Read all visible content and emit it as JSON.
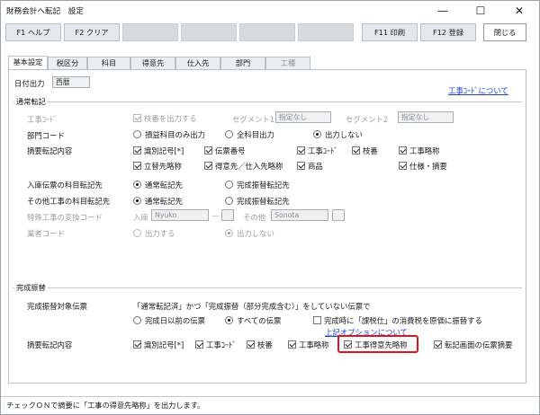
{
  "window": {
    "title": "財務会計へ転記　設定",
    "minimize": "—",
    "maximize": "☐",
    "close": "✕"
  },
  "toolbar": {
    "f1": "F1 ヘルプ",
    "f2": "F2 クリア",
    "f11": "F11 印刷",
    "f12": "F12 登録",
    "close": "閉じる"
  },
  "tabs": [
    "基本設定",
    "税区分",
    "科目",
    "得意先",
    "仕入先",
    "部門",
    "工種"
  ],
  "header": {
    "date_output_label": "日付出力",
    "date_output_value": "西暦",
    "koji_code_link": "工事ｺｰﾄﾞについて"
  },
  "normal": {
    "group_label": "通常転記",
    "koji_code": {
      "label": "工事ｺｰﾄﾞ",
      "checkbox": "枝番を出力する",
      "seg1_label": "セグメント1",
      "seg1_value": "指定なし",
      "seg2_label": "セグメント2",
      "seg2_value": "指定なし"
    },
    "bumon": {
      "label": "部門コード",
      "opt1": "損益科目のみ出力",
      "opt2": "全科目出力",
      "opt3": "出力しない"
    },
    "tekiyo": {
      "label": "摘要転記内容",
      "row1": [
        "識別記号[*]",
        "伝票番号",
        "工事ｺｰﾄﾞ",
        "枝番",
        "工事略称"
      ],
      "row2": [
        "立替先略称",
        "得意先／仕入先略称",
        "商品",
        "仕様・摘要"
      ]
    },
    "nyuko": {
      "label": "入庫伝票の科目転記先",
      "opt1": "通常転記先",
      "opt2": "完成振替転記先"
    },
    "sonota": {
      "label": "その他工事の科目転記先",
      "opt1": "通常転記先",
      "opt2": "完成振替転記先"
    },
    "tokushu": {
      "label": "特殊工事の変換コード",
      "in_label": "入庫",
      "in_value": "Nyuko",
      "other_label": "その他",
      "other_value": "Sonota",
      "dash": "—"
    },
    "gyosha": {
      "label": "業者コード",
      "opt1": "出力する",
      "opt2": "出力しない"
    }
  },
  "complete": {
    "group_label": "完成振替",
    "target_label": "完成振替対象伝票",
    "target_desc": "「通常転記済」かつ「完成振替（部分完成含む）」をしていない伝票で",
    "opt1": "完成日以前の伝票",
    "opt2": "すべての伝票",
    "check": "完成時に「課税仕」の消費税を原価に振替する",
    "option_link": "上記オプションについて",
    "tekiyo_label": "摘要転記内容",
    "items": [
      "識別記号[*]",
      "工事ｺｰﾄﾞ",
      "枝番",
      "工事略称",
      "工事得意先略称",
      "転記画面の伝票摘要"
    ]
  },
  "status": "チェックＯＮで摘要に「工事の得意先略称」を出力します。",
  "colors": {
    "highlight": "#e0141e",
    "link": "#1a3fd1"
  }
}
